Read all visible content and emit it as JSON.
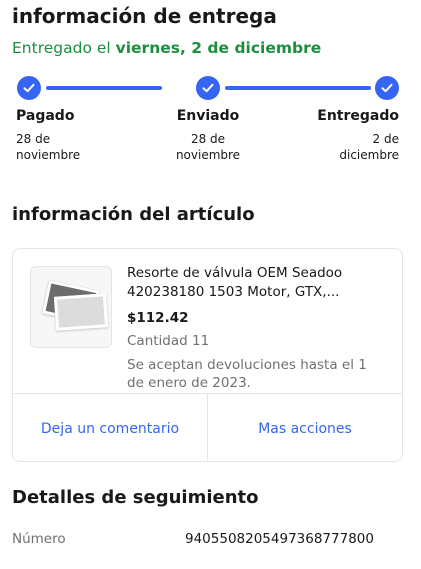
{
  "delivery": {
    "title": "información de entrega",
    "date_prefix": "Entregado el ",
    "date_value": "viernes, 2 de diciembre",
    "accent_color": "#1c8f3e"
  },
  "progress": {
    "color": "#3665f3",
    "steps": [
      {
        "label": "Pagado",
        "date_line1": "28 de",
        "date_line2": "noviembre"
      },
      {
        "label": "Enviado",
        "date_line1": "28 de",
        "date_line2": "noviembre"
      },
      {
        "label": "Entregado",
        "date_line1": "2 de",
        "date_line2": "diciembre"
      }
    ]
  },
  "item_section": {
    "title": "información del artículo",
    "item": {
      "name": "Resorte de válvula OEM Seadoo 420238180 1503 Motor, GTX,...",
      "price": "$112.42",
      "quantity": "Cantidad 11",
      "returns": "Se aceptan devoluciones hasta el 1 de enero de 2023."
    },
    "actions": {
      "comment": "Deja un comentario",
      "more": "Mas acciones"
    }
  },
  "tracking": {
    "title": "Detalles de seguimiento",
    "label": "Número",
    "value": "9405508205497368777800"
  }
}
